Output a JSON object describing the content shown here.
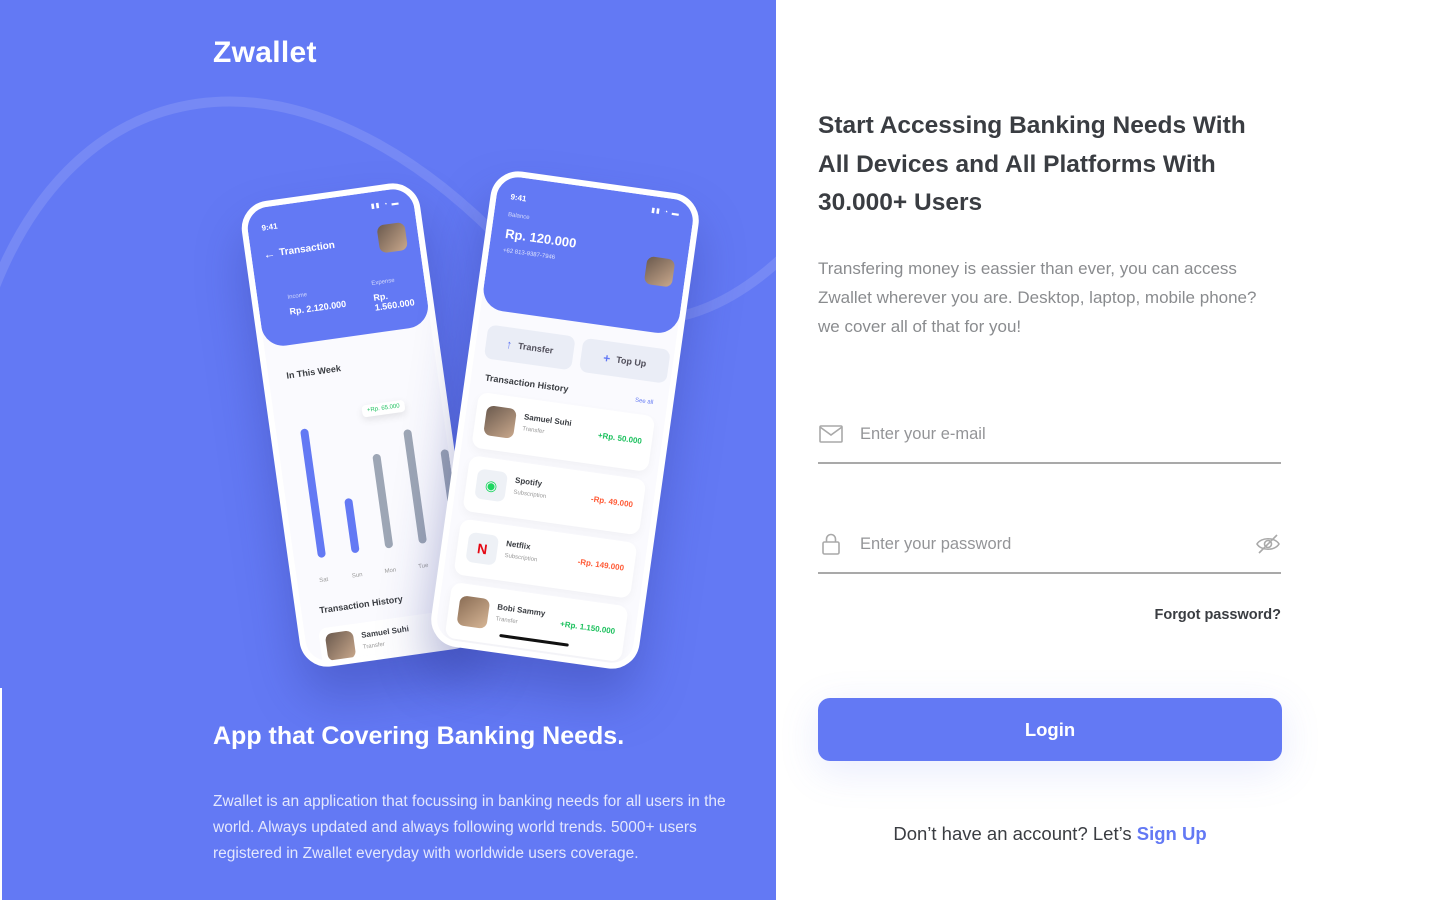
{
  "brand": {
    "name": "Zwallet"
  },
  "hero": {
    "title": "App that Covering Banking Needs.",
    "description": "Zwallet is an application that focussing in banking needs for all users in the world. Always updated and always following world trends. 5000+ users registered in Zwallet everyday with worldwide users coverage."
  },
  "mockup": {
    "transaction_screen": {
      "time": "9:41",
      "title": "Transaction",
      "income_label": "Income",
      "income_value": "Rp. 2.120.000",
      "expense_label": "Expense",
      "expense_value": "Rp. 1.560.000",
      "week_label": "In This Week",
      "badge": "+Rp. 65.000",
      "days": [
        "Sat",
        "Sun",
        "Mon",
        "Tue"
      ],
      "history_label": "Transaction History",
      "row_name": "Samuel Suhi",
      "row_sub": "Transfer"
    },
    "home_screen": {
      "time": "9:41",
      "balance_label": "Balance",
      "balance_value": "Rp. 120.000",
      "phone": "+62 813-9387-7946",
      "transfer_label": "Transfer",
      "topup_label": "Top Up",
      "history_label": "Transaction History",
      "see_all": "See all",
      "rows": [
        {
          "name": "Samuel Suhi",
          "sub": "Transfer",
          "amount": "+Rp. 50.000"
        },
        {
          "name": "Spotify",
          "sub": "Subscription",
          "amount": "-Rp. 49.000"
        },
        {
          "name": "Netflix",
          "sub": "Subscription",
          "amount": "-Rp. 149.000"
        },
        {
          "name": "Bobi Sammy",
          "sub": "Transfer",
          "amount": "+Rp. 1.150.000"
        }
      ]
    }
  },
  "login": {
    "heading": "Start Accessing Banking Needs With All Devices and All Platforms With 30.000+ Users",
    "description": "Transfering money is eassier than ever, you can access Zwallet wherever you are. Desktop, laptop, mobile phone? we cover all of that for you!",
    "email_placeholder": "Enter your e-mail",
    "password_placeholder": "Enter your password",
    "forgot_password": "Forgot password?",
    "login_button": "Login",
    "signup_prompt": "Don’t have an account? Let’s",
    "signup_link": "Sign Up"
  },
  "colors": {
    "primary": "#6379f4",
    "text": "#3a3d42",
    "positive": "#1ec15f",
    "negative": "#ff5b37"
  },
  "icons": {
    "email": "mail-icon",
    "password": "lock-icon",
    "toggle": "eye-crossed-icon"
  }
}
